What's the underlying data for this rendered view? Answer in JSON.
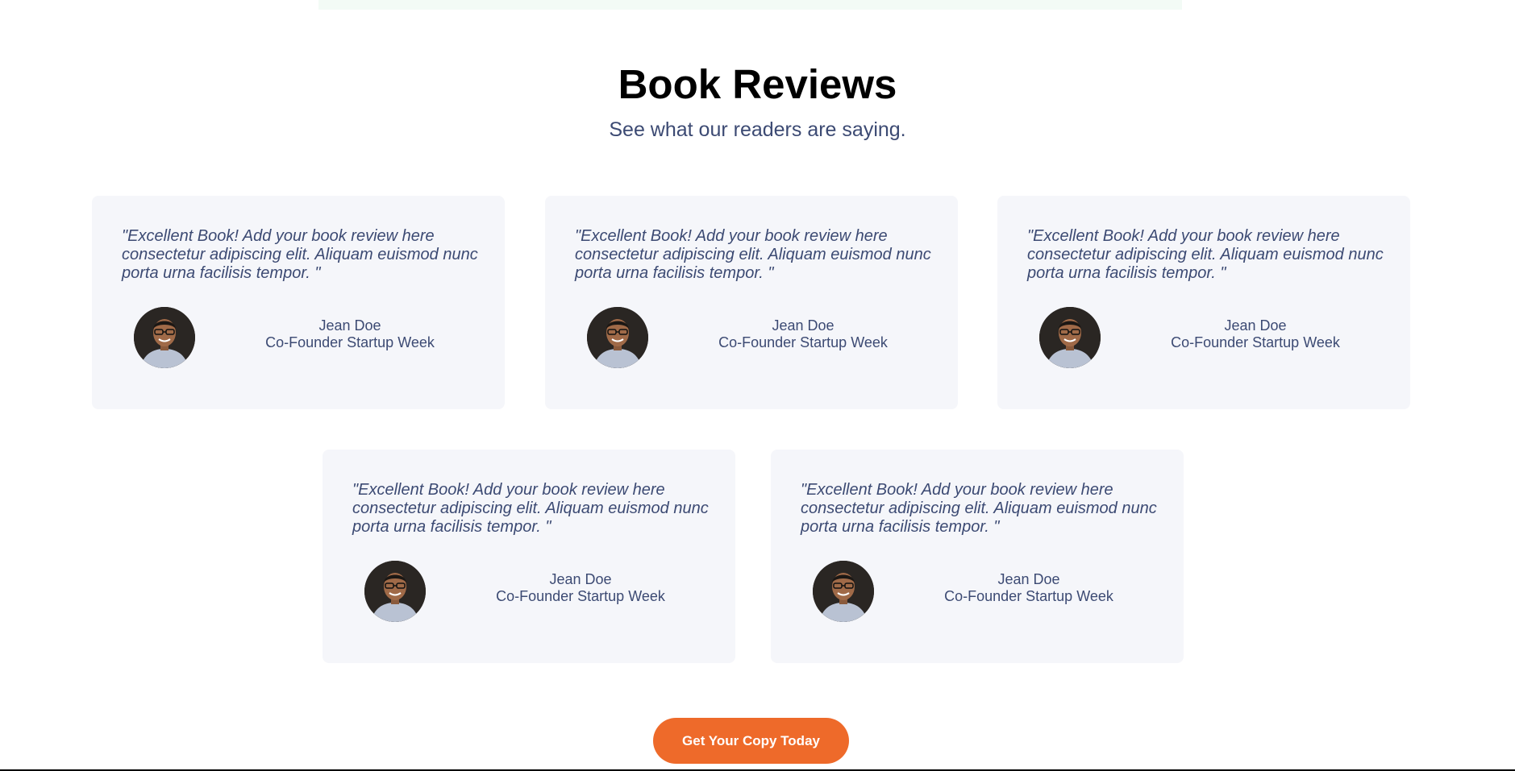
{
  "section": {
    "title": "Book Reviews",
    "subtitle": "See what our readers are saying."
  },
  "reviews": [
    {
      "quote": "\"Excellent Book! Add your book review here consectetur adipiscing elit. Aliquam euismod nunc porta urna facilisis tempor. \"",
      "name": "Jean Doe",
      "role": "Co-Founder Startup Week"
    },
    {
      "quote": "\"Excellent Book! Add your book review here consectetur adipiscing elit. Aliquam euismod nunc porta urna facilisis tempor. \"",
      "name": "Jean Doe",
      "role": "Co-Founder Startup Week"
    },
    {
      "quote": "\"Excellent Book! Add your book review here consectetur adipiscing elit. Aliquam euismod nunc porta urna facilisis tempor. \"",
      "name": "Jean Doe",
      "role": "Co-Founder Startup Week"
    },
    {
      "quote": "\"Excellent Book! Add your book review here consectetur adipiscing elit. Aliquam euismod nunc porta urna facilisis tempor. \"",
      "name": "Jean Doe",
      "role": "Co-Founder Startup Week"
    },
    {
      "quote": "\"Excellent Book! Add your book review here consectetur adipiscing elit. Aliquam euismod nunc porta urna facilisis tempor. \"",
      "name": "Jean Doe",
      "role": "Co-Founder Startup Week"
    }
  ],
  "cta": {
    "label": "Get Your Copy Today"
  },
  "colors": {
    "accent": "#ee6a2a",
    "text_muted": "#3c4a73",
    "card_bg": "#f5f6fa"
  },
  "icons": {
    "avatar": "reviewer-avatar-photo"
  }
}
